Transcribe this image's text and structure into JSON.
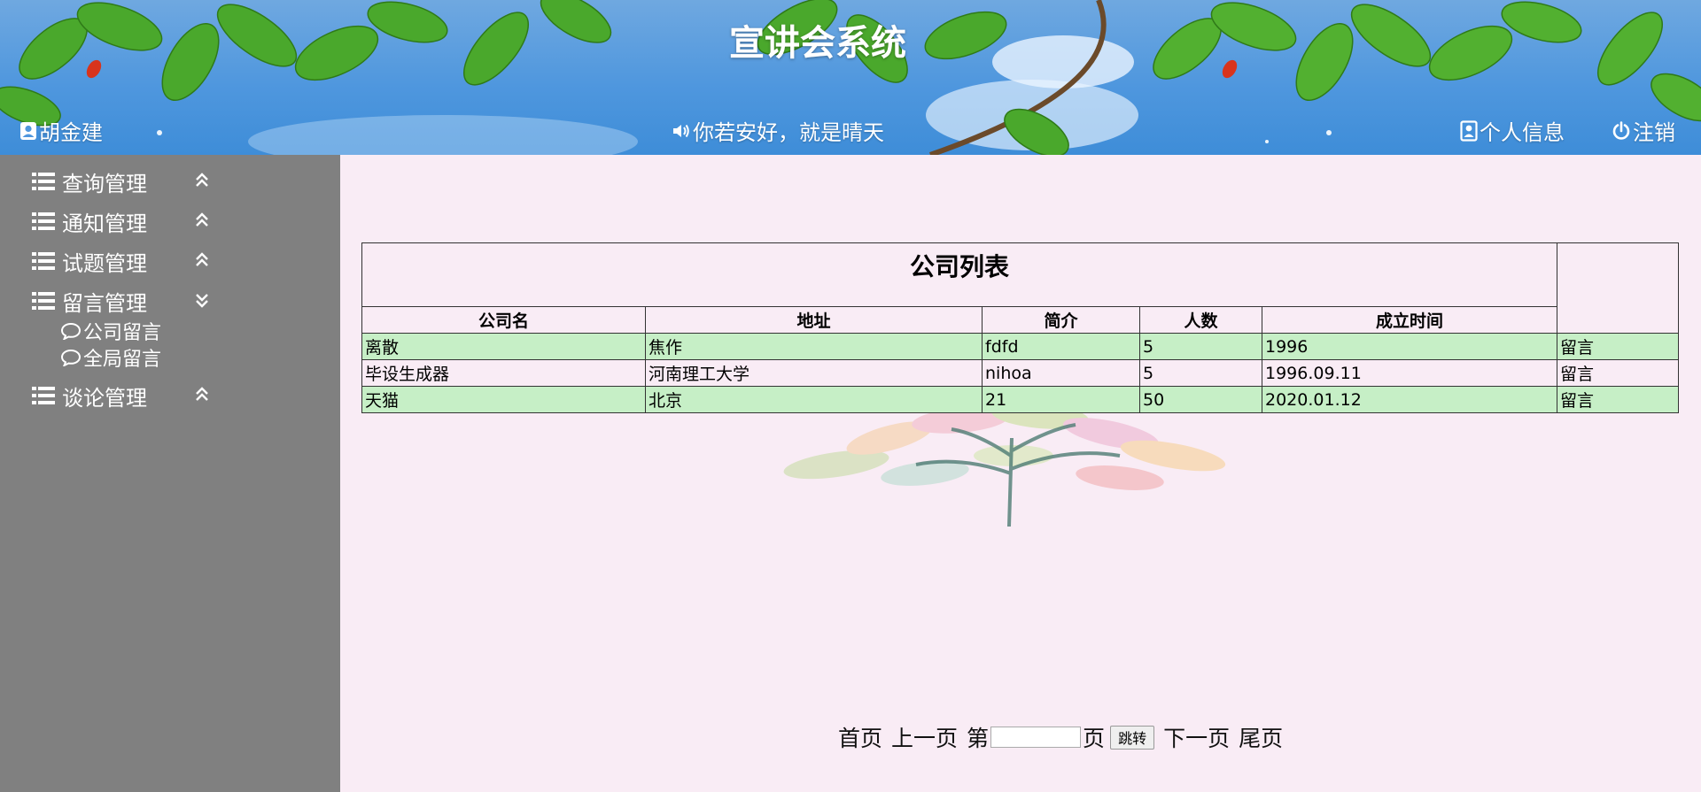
{
  "header": {
    "title": "宣讲会系统",
    "user_name": "胡金建",
    "greeting": "你若安好，就是晴天",
    "profile_label": "个人信息",
    "logout_label": "注销"
  },
  "sidebar": {
    "items": [
      {
        "label": "查询管理",
        "expanded": false
      },
      {
        "label": "通知管理",
        "expanded": false
      },
      {
        "label": "试题管理",
        "expanded": false
      },
      {
        "label": "留言管理",
        "expanded": true,
        "children": [
          {
            "label": "公司留言"
          },
          {
            "label": "全局留言"
          }
        ]
      },
      {
        "label": "谈论管理",
        "expanded": false
      }
    ]
  },
  "table": {
    "caption": "公司列表",
    "columns": [
      "公司名",
      "地址",
      "简介",
      "人数",
      "成立时间"
    ],
    "rows": [
      {
        "name": "离散",
        "address": "焦作",
        "intro": "fdfd",
        "count": "5",
        "founded": "1996",
        "action": "留言"
      },
      {
        "name": "毕设生成器",
        "address": "河南理工大学",
        "intro": "nihoa",
        "count": "5",
        "founded": "1996.09.11",
        "action": "留言"
      },
      {
        "name": "天猫",
        "address": "北京",
        "intro": "21",
        "count": "50",
        "founded": "2020.01.12",
        "action": "留言"
      }
    ]
  },
  "pager": {
    "first": "首页",
    "prev": "上一页",
    "page_prefix": "第",
    "page_suffix": "页",
    "page_value": "",
    "jump": "跳转",
    "next": "下一页",
    "last": "尾页"
  },
  "colors": {
    "sidebar_bg": "#808080",
    "main_bg": "#f9ecf5",
    "row_highlight": "#c6efc6",
    "header_sky": "#4f97de"
  }
}
